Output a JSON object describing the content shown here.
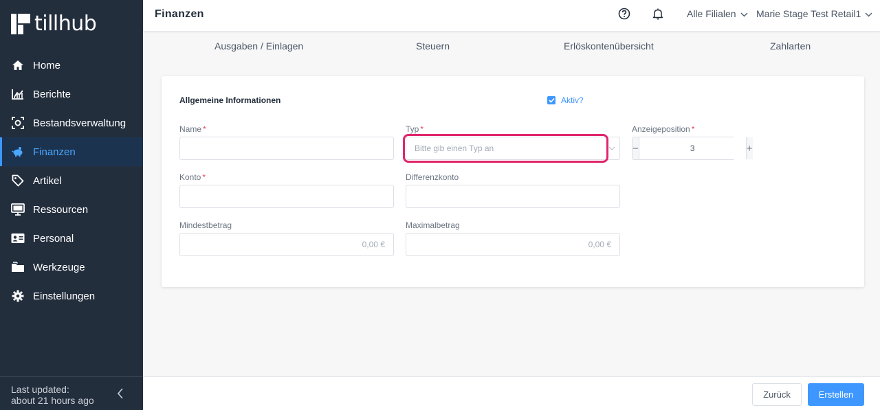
{
  "app": {
    "logo_text": "tillhub"
  },
  "sidebar": {
    "items": [
      {
        "label": "Home",
        "icon": "home-icon",
        "active": false
      },
      {
        "label": "Berichte",
        "icon": "chart-icon",
        "active": false
      },
      {
        "label": "Bestandsverwaltung",
        "icon": "inventory-icon",
        "active": false
      },
      {
        "label": "Finanzen",
        "icon": "piggy-bank-icon",
        "active": true
      },
      {
        "label": "Artikel",
        "icon": "tag-icon",
        "active": false
      },
      {
        "label": "Ressourcen",
        "icon": "monitor-icon",
        "active": false
      },
      {
        "label": "Personal",
        "icon": "id-card-icon",
        "active": false
      },
      {
        "label": "Werkzeuge",
        "icon": "folder-icon",
        "active": false
      },
      {
        "label": "Einstellungen",
        "icon": "gear-icon",
        "active": false
      }
    ],
    "footer": {
      "line1": "Last updated:",
      "line2": "about 21 hours ago"
    }
  },
  "header": {
    "title": "Finanzen",
    "branch_select": "Alle Filialen",
    "account_select": "Marie Stage Test Retail1"
  },
  "tabs": [
    {
      "label": "Ausgaben / Einlagen"
    },
    {
      "label": "Steuern"
    },
    {
      "label": "Erlöskontenübersicht"
    },
    {
      "label": "Zahlarten"
    }
  ],
  "form": {
    "section_title": "Allgemeine Informationen",
    "active_label": "Aktiv?",
    "active_checked": true,
    "required_mark": "*",
    "name": {
      "label": "Name",
      "value": ""
    },
    "type": {
      "label": "Typ",
      "placeholder": "Bitte gib einen Typ an"
    },
    "position": {
      "label": "Anzeigeposition",
      "value": "3",
      "minus": "−",
      "plus": "+"
    },
    "account": {
      "label": "Konto",
      "value": ""
    },
    "diff_account": {
      "label": "Differenzkonto",
      "value": ""
    },
    "min_amount": {
      "label": "Mindestbetrag",
      "placeholder": "0,00 €"
    },
    "max_amount": {
      "label": "Maximalbetrag",
      "placeholder": "0,00 €"
    }
  },
  "actions": {
    "back_label": "Zurück",
    "create_label": "Erstellen"
  },
  "colors": {
    "sidebar_bg": "#232e3d",
    "accent": "#3d97ff",
    "required": "#e5485c",
    "highlight": "#e0266b"
  }
}
